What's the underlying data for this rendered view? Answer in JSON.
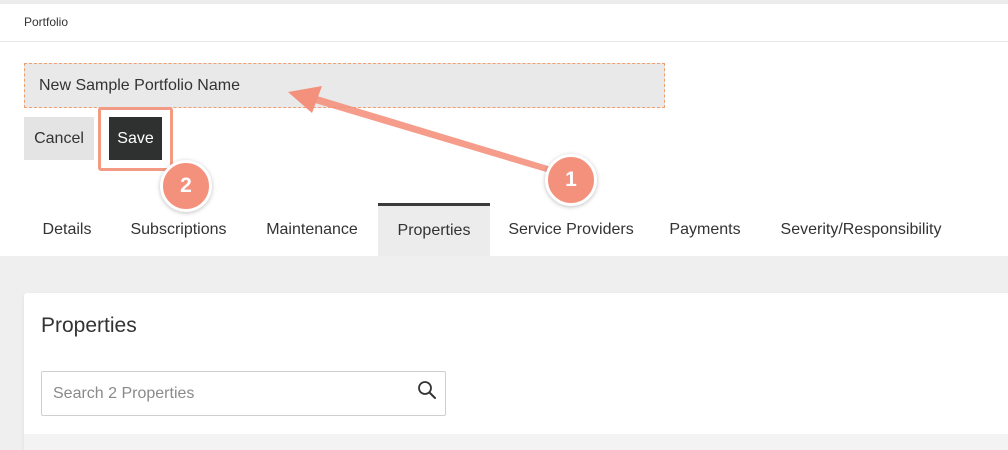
{
  "header": {
    "breadcrumb": "Portfolio"
  },
  "portfolio_name": {
    "value": "New Sample Portfolio Name"
  },
  "actions": {
    "cancel_label": "Cancel",
    "save_label": "Save"
  },
  "tabs": [
    {
      "label": "Details",
      "active": false
    },
    {
      "label": "Subscriptions",
      "active": false
    },
    {
      "label": "Maintenance",
      "active": false
    },
    {
      "label": "Properties",
      "active": true
    },
    {
      "label": "Service Providers",
      "active": false
    },
    {
      "label": "Payments",
      "active": false
    },
    {
      "label": "Severity/Responsibility",
      "active": false
    }
  ],
  "properties_section": {
    "title": "Properties",
    "search": {
      "placeholder": "Search 2 Properties",
      "value": "",
      "icon": "search-icon"
    }
  },
  "annotations": [
    {
      "label": "1",
      "color": "#f4917d"
    },
    {
      "label": "2",
      "color": "#f4917d"
    }
  ],
  "colors": {
    "accent": "#f4917d",
    "save_bg": "#2f3130",
    "field_border": "#f0a070"
  }
}
